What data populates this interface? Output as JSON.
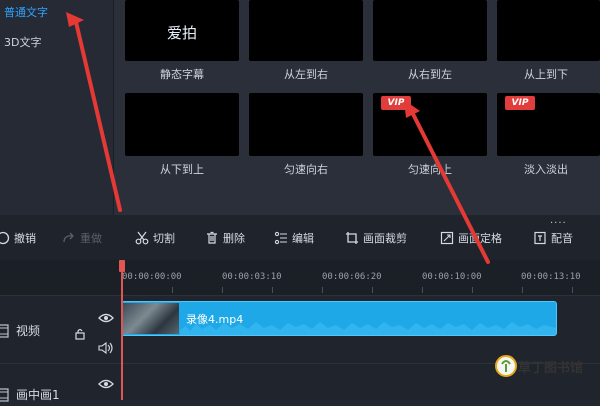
{
  "left_panel": {
    "items": [
      {
        "label": "普通文字",
        "active": true
      },
      {
        "label": "3D文字",
        "active": false
      }
    ]
  },
  "templates": [
    {
      "label": "静态字幕",
      "preview_text": "爱拍",
      "vip": false
    },
    {
      "label": "从左到右",
      "preview_text": "",
      "vip": false
    },
    {
      "label": "从右到左",
      "preview_text": "",
      "vip": false
    },
    {
      "label": "从上到下",
      "preview_text": "",
      "vip": false
    },
    {
      "label": "从下到上",
      "preview_text": "",
      "vip": false
    },
    {
      "label": "匀速向右",
      "preview_text": "",
      "vip": false
    },
    {
      "label": "匀速向上",
      "preview_text": "",
      "vip": true
    },
    {
      "label": "淡入淡出",
      "preview_text": "",
      "vip": true
    }
  ],
  "vip_badge": "VIP",
  "toolbar": {
    "more": "....",
    "items": [
      {
        "label": "撤销",
        "icon": "undo-icon",
        "disabled": false
      },
      {
        "label": "重做",
        "icon": "redo-icon",
        "disabled": true
      },
      {
        "label": "切割",
        "icon": "scissors-icon",
        "disabled": false
      },
      {
        "label": "删除",
        "icon": "trash-icon",
        "disabled": false
      },
      {
        "label": "编辑",
        "icon": "edit-icon",
        "disabled": false
      },
      {
        "label": "画面裁剪",
        "icon": "crop-icon",
        "disabled": false
      },
      {
        "label": "画面定格",
        "icon": "freeze-frame-icon",
        "disabled": false
      },
      {
        "label": "配音",
        "icon": "dubbing-icon",
        "disabled": false
      }
    ]
  },
  "ruler": {
    "ticks": [
      "00:00:00:00",
      "00:00:03:10",
      "00:00:06:20",
      "00:00:10:00",
      "00:00:13:10"
    ]
  },
  "tracks": [
    {
      "label": "视频",
      "icon": "film-icon"
    },
    {
      "label": "画中画1",
      "icon": "film-icon"
    }
  ],
  "clip": {
    "title": "录像4.mp4"
  },
  "watermark": {
    "text": "草丁图书馆"
  },
  "colors": {
    "accent": "#2fa3ff",
    "clip": "#1fa8e8",
    "playhead": "#e25555",
    "vip": "#e23d3d",
    "annotation_arrow": "#e53935"
  }
}
